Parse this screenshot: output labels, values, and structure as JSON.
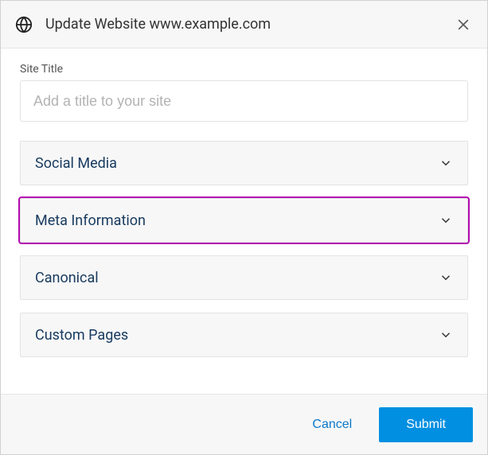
{
  "dialog": {
    "title": "Update Website www.example.com",
    "site_title_label": "Site Title",
    "site_title_placeholder": "Add a title to your site",
    "site_title_value": "",
    "sections": [
      {
        "label": "Social Media"
      },
      {
        "label": "Meta Information",
        "highlighted": true
      },
      {
        "label": "Canonical"
      },
      {
        "label": "Custom Pages"
      }
    ],
    "footer": {
      "cancel_label": "Cancel",
      "submit_label": "Submit"
    }
  }
}
